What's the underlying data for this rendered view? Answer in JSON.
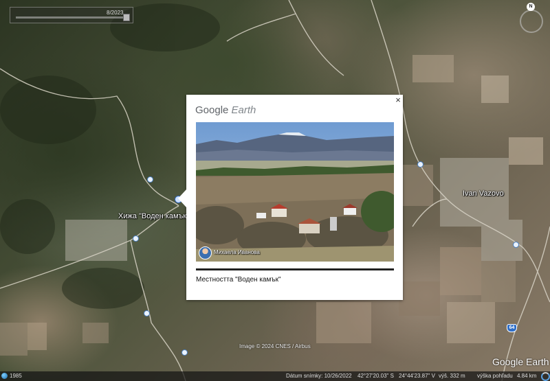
{
  "map": {
    "timeline_date": "8/2023",
    "compass_label": "N",
    "place_labels": {
      "hut": "Хижа \"Воден камък",
      "village": "Ivan Vazovo"
    },
    "route_shields": [
      "64"
    ],
    "attribution": "Image © 2024 CNES / Airbus",
    "brand": "Google Earth"
  },
  "balloon": {
    "logo_google": "Google",
    "logo_earth": "Earth",
    "close_label": "×",
    "photo_author": "Михаела Иванова",
    "caption": "Местността \"Воден камък\""
  },
  "status_bar": {
    "year": "1985",
    "imagery_date": "Dátum snímky: 10/26/2022",
    "latitude": "42°27'20.03\" S",
    "longitude": "24°44'23.87\" V",
    "elevation": "výš.   332 m",
    "view_altitude": "výška pohľadu",
    "view_distance": "4.84 km"
  },
  "colors": {
    "balloon_bg": "#ffffff",
    "status_bg": "#141414",
    "marker_blue": "#2d6ec9"
  }
}
